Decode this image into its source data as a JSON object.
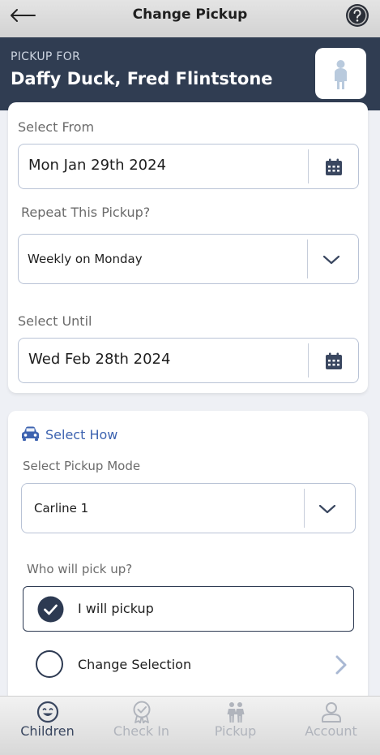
{
  "header": {
    "title": "Change Pickup"
  },
  "banner": {
    "label": "PICKUP FOR",
    "names": "Daffy Duck, Fred Flintstone"
  },
  "schedule": {
    "select_from_label": "Select From",
    "select_from_value": "Mon Jan 29th 2024",
    "repeat_label": "Repeat This Pickup?",
    "repeat_value": "Weekly on Monday",
    "select_until_label": "Select Until",
    "select_until_value": "Wed Feb 28th 2024"
  },
  "how": {
    "section_title": "Select How",
    "mode_label": "Select Pickup Mode",
    "mode_value": "Carline 1",
    "who_label": "Who will pick up?",
    "option_selected": "I will pickup",
    "option_change": "Change Selection"
  },
  "tabs": [
    {
      "label": "Children",
      "icon": "smile-icon",
      "active": true
    },
    {
      "label": "Check In",
      "icon": "check-badge-icon",
      "active": false
    },
    {
      "label": "Pickup",
      "icon": "people-icon",
      "active": false
    },
    {
      "label": "Account",
      "icon": "user-icon",
      "active": false
    }
  ],
  "colors": {
    "banner": "#303d52",
    "accent": "#3d63b0",
    "field_border": "#b9c3d6"
  }
}
